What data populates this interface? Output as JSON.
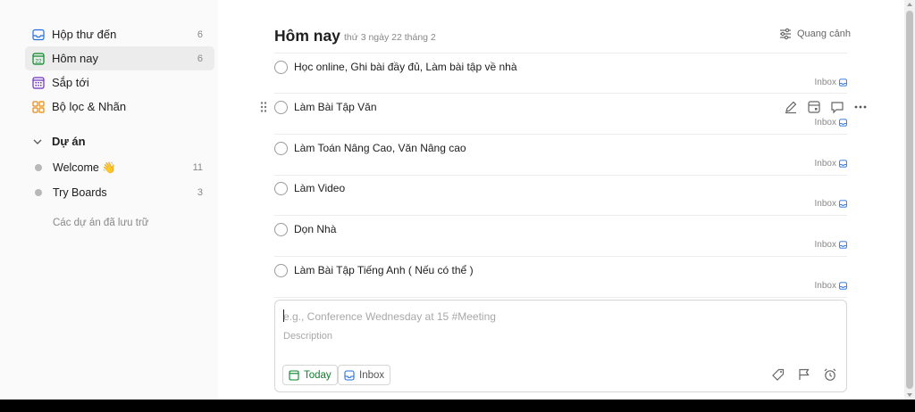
{
  "sidebar": {
    "nav": [
      {
        "label": "Hộp thư đến",
        "count": "6",
        "icon": "inbox-icon",
        "color": "#246fe0"
      },
      {
        "label": "Hôm nay",
        "count": "6",
        "icon": "calendar-today-icon",
        "day": "22",
        "color": "#058527"
      },
      {
        "label": "Sắp tới",
        "count": "",
        "icon": "calendar-upcoming-icon",
        "color": "#692fc2"
      },
      {
        "label": "Bộ lọc & Nhãn",
        "count": "",
        "icon": "filters-labels-icon",
        "color": "#eb8909"
      }
    ],
    "projects_header": "Dự án",
    "projects": [
      {
        "label": "Welcome 👋",
        "count": "11"
      },
      {
        "label": "Try Boards",
        "count": "3"
      }
    ],
    "archived_label": "Các dự án đã lưu trữ"
  },
  "main": {
    "title": "Hôm nay",
    "date": "thứ 3 ngày 22 tháng 2",
    "view_label": "Quang cảnh",
    "tasks": [
      {
        "text": "Học online, Ghi bài đầy đủ, Làm bài tập về nhà",
        "project": "Inbox"
      },
      {
        "text": "Làm Bài Tập Văn",
        "project": "Inbox"
      },
      {
        "text": "Làm Toán Nâng Cao, Văn Nâng cao",
        "project": "Inbox"
      },
      {
        "text": "Làm Video",
        "project": "Inbox"
      },
      {
        "text": "Dọn Nhà",
        "project": "Inbox"
      },
      {
        "text": "Làm Bài Tập Tiếng Anh ( Nếu có thể )",
        "project": "Inbox"
      }
    ],
    "editor": {
      "title_placeholder": "e.g., Conference Wednesday at 15 #Meeting",
      "description_placeholder": "Description",
      "due_chip": "Today",
      "project_chip": "Inbox"
    }
  },
  "colors": {
    "accent_green": "#058527",
    "muted_text": "#888888",
    "sidebar_bg": "#fafafa"
  }
}
